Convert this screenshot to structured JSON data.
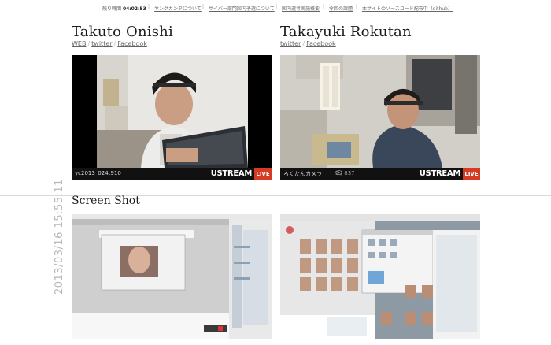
{
  "topnav": {
    "remain_label": "残り時間",
    "remain_time": "04:02:53",
    "links": [
      "ヤングカンタについて",
      "サイバー部門国内予選について",
      "国内選考実施概要",
      "今回の課題",
      "本サイトのソースコード配布中（github）"
    ]
  },
  "contestants": [
    {
      "name": "Takuto Onishi",
      "links": [
        "WEB",
        "twitter",
        "Facebook"
      ],
      "stream": {
        "caption": "yc2013_024t910",
        "views": "",
        "logo": "USTREAM",
        "live": "LIVE"
      }
    },
    {
      "name": "Takayuki Rokutan",
      "links": [
        "twitter",
        "Facebook"
      ],
      "stream": {
        "caption": "ろくたんカメラ",
        "views": "5 / 837",
        "logo": "USTREAM",
        "live": "LIVE"
      }
    }
  ],
  "screenshot_section": {
    "title": "Screen Shot",
    "timestamp": "2013/03/16 15:55:11"
  },
  "colors": {
    "live_red": "#d53a22",
    "divider": "#d9d9d9",
    "timestamp_gray": "#b8b8b8"
  }
}
